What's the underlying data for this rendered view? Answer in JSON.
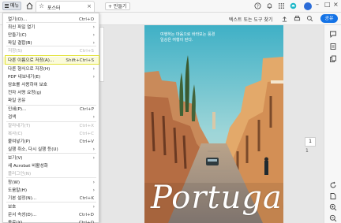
{
  "topbar": {
    "menu_label": "메뉴",
    "tab_title": "포스터",
    "new_tab_label": "+ 만들기"
  },
  "toolbar2": {
    "search_label": "텍스트 또는 도구 찾기",
    "share_label": "공유"
  },
  "menu": {
    "items": [
      {
        "label": "열기(O)...",
        "shortcut": "Ctrl+O",
        "arrow": "",
        "disabled": false
      },
      {
        "label": "최신 파일 열기",
        "shortcut": "",
        "arrow": "›",
        "disabled": false
      },
      {
        "label": "만들기(C)",
        "shortcut": "",
        "arrow": "›",
        "disabled": false
      },
      {
        "label": "파일 결합(B)",
        "shortcut": "",
        "arrow": "›",
        "disabled": false
      },
      {
        "label": "저장(S)",
        "shortcut": "Ctrl+S",
        "arrow": "",
        "disabled": true
      },
      {
        "label": "다른 이름으로 저장(A)...",
        "shortcut": "Shift+Ctrl+S",
        "arrow": "",
        "disabled": false,
        "highlight": true
      },
      {
        "label": "다른 형식으로 저장(H)",
        "shortcut": "",
        "arrow": "›",
        "disabled": false
      },
      {
        "label": "PDF 내보내기(E)",
        "shortcut": "",
        "arrow": "›",
        "disabled": false
      },
      {
        "label": "암호를 사용하여 보호",
        "shortcut": "",
        "arrow": "",
        "disabled": false
      },
      {
        "label": "전자 서명 요청(g)",
        "shortcut": "",
        "arrow": "",
        "disabled": false
      },
      {
        "label": "파일 공유",
        "shortcut": "",
        "arrow": "",
        "disabled": false
      },
      {
        "label": "인쇄(P)...",
        "shortcut": "Ctrl+P",
        "arrow": "",
        "disabled": false
      },
      {
        "label": "검색",
        "shortcut": "",
        "arrow": "›",
        "disabled": false
      },
      {
        "label": "잘라내기(T)",
        "shortcut": "Ctrl+X",
        "arrow": "",
        "disabled": true
      },
      {
        "label": "복사(C)",
        "shortcut": "Ctrl+C",
        "arrow": "",
        "disabled": true
      },
      {
        "label": "붙여넣기(P)",
        "shortcut": "Ctrl+V",
        "arrow": "",
        "disabled": false
      },
      {
        "label": "실행 취소, 다시 실행 등(U)",
        "shortcut": "",
        "arrow": "›",
        "disabled": false
      },
      {
        "label": "보기(V)",
        "shortcut": "",
        "arrow": "›",
        "disabled": false
      },
      {
        "label": "새 Acrobat 비활성화",
        "shortcut": "",
        "arrow": "",
        "disabled": false
      },
      {
        "label": "플러그인(N)",
        "shortcut": "",
        "arrow": "",
        "disabled": true
      },
      {
        "label": "창(W)",
        "shortcut": "",
        "arrow": "›",
        "disabled": false
      },
      {
        "label": "도움말(H)",
        "shortcut": "",
        "arrow": "›",
        "disabled": false
      },
      {
        "label": "기본 설정(N)...",
        "shortcut": "Ctrl+K",
        "arrow": "",
        "disabled": false
      },
      {
        "label": "보호",
        "shortcut": "",
        "arrow": "›",
        "disabled": false
      },
      {
        "label": "문서 속성(D)...",
        "shortcut": "Ctrl+D",
        "arrow": "",
        "disabled": false
      },
      {
        "label": "종료(X)",
        "shortcut": "Ctrl+Q",
        "arrow": "",
        "disabled": false
      }
    ]
  },
  "poster": {
    "caption_line1": "여행하는 마음으로 바라보는 풍경",
    "caption_line2": "일상은 여행이 된다.",
    "title": "Portugal"
  },
  "page_nav": {
    "current_page": "1",
    "total": "1"
  },
  "colors": {
    "accent": "#1473e6",
    "highlight_border": "#e3e33a",
    "sky": "#55b9c9"
  }
}
